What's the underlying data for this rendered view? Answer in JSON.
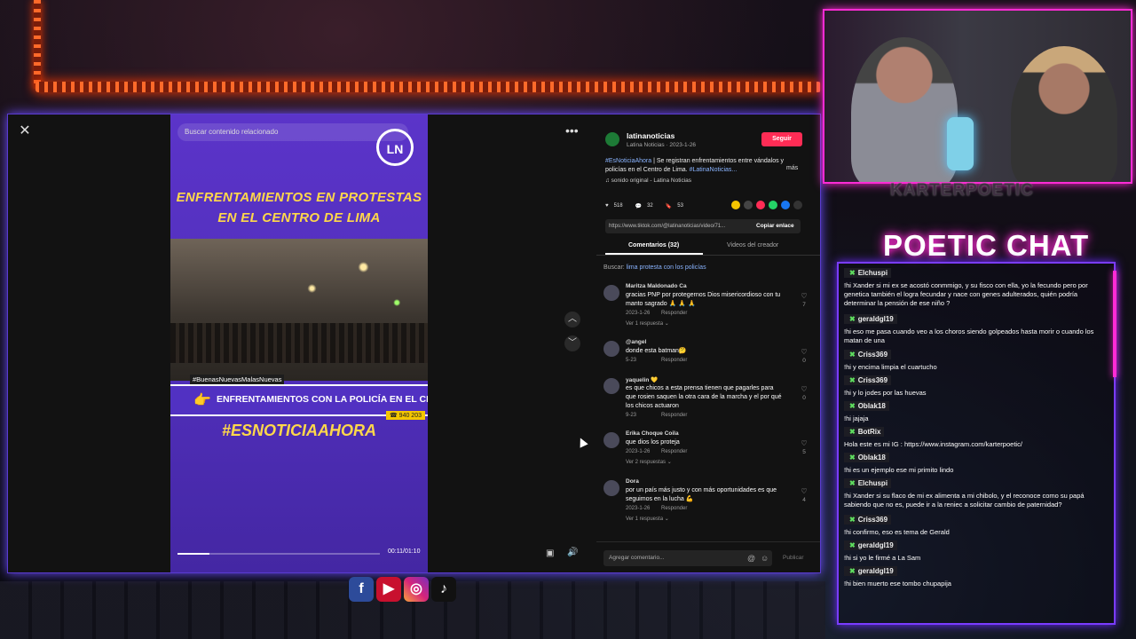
{
  "video": {
    "search_placeholder": "Buscar contenido relacionado",
    "logo_text": "LN",
    "headline_line1": "ENFRENTAMIENTOS EN PROTESTAS",
    "headline_line2": "EN EL CENTRO DE LIMA",
    "tag": "#BuenasNuevasMalasNuevas",
    "lower_third": "ENFRENTAMIENTOS CON LA POLICÍA EN EL CENTRO DE",
    "phone": "940 203",
    "hashtag": "#ESNOTICIAAHORA",
    "time": "00:11/01:10",
    "progress": 0.16
  },
  "post": {
    "account": "latinanoticias",
    "subtitle": "Latina Noticias · 2023-1-26",
    "follow_label": "Seguir",
    "desc_tag1": "#EsNoticiaAhora",
    "desc_text": " | Se registran enfrentamientos entre vándalos y policías en el Centro de Lima. ",
    "desc_tag2": "#LatinaNoticias...",
    "more_label": "más",
    "music": "♫ sonido original - Latina Noticias",
    "likes": "518",
    "comments": "32",
    "saves": "53",
    "link": "https://www.tiktok.com/@latinanoticias/video/71...",
    "copy_label": "Copiar enlace",
    "tab_comments": "Comentarios (32)",
    "tab_videos": "Videos del creador",
    "search_label": "Buscar:",
    "search_term": "lima protesta con los policías"
  },
  "comments": [
    {
      "user": "Maritza Maldonado Ca",
      "text": "gracias PNP por protegernos Dios misericordioso con tu manto sagrado 🙏 🙏 🙏",
      "date": "2023-1-26",
      "reply": "Responder",
      "likes": "7",
      "replies": "Ver 1 respuesta ⌄"
    },
    {
      "user": "@angel",
      "text": "donde esta batman🤔",
      "date": "5-23",
      "reply": "Responder",
      "likes": "0",
      "replies": ""
    },
    {
      "user": "yaquelin 💛",
      "text": "es que chicos a esta prensa tienen que pagarles para que rosien saquen la otra cara de la marcha y el por qué los chicos actuaron",
      "date": "9-23",
      "reply": "Responder",
      "likes": "0",
      "replies": ""
    },
    {
      "user": "Erika Choque Coila",
      "text": "que dios los proteja",
      "date": "2023-1-26",
      "reply": "Responder",
      "likes": "5",
      "replies": "Ver 2 respuestas ⌄"
    },
    {
      "user": "Dora",
      "text": "por un país más justo y con más oportunidades es que seguimos en la lucha 💪",
      "date": "2023-1-26",
      "reply": "Responder",
      "likes": "4",
      "replies": "Ver 1 respuesta ⌄"
    }
  ],
  "add_comment": {
    "placeholder": "Agregar comentario...",
    "publish": "Publicar"
  },
  "streamer": {
    "name": "KARTERPOETIC",
    "chat_title": "POETIC CHAT"
  },
  "chat": [
    {
      "name": "Elchuspi",
      "text": "!hi Xander si mi ex se acostó conmmigo, y su fisco con ella, yo la fecundo pero por genetica también el logra fecundar y nace con genes adulterados, quién podría determinar la pensión de ese niño ?"
    },
    {
      "name": "geraldgl19",
      "text": "!hi eso me pasa cuando veo a los choros siendo golpeados hasta morir o cuando los matan de una"
    },
    {
      "name": "Criss369",
      "text": "!hi y encima limpia el cuartucho"
    },
    {
      "name": "Criss369",
      "text": "!hi y lo jodes por las huevas"
    },
    {
      "name": "Oblak18",
      "text": "!hi jajaja"
    },
    {
      "name": "BotRix",
      "text": "Hola este es mi IG : https://www.instagram.com/karterpoetic/"
    },
    {
      "name": "Oblak18",
      "text": "!hi es un ejemplo ese mi primito lindo"
    },
    {
      "name": "Elchuspi",
      "text": "!hi Xander si su flaco de mi ex alimenta a mi chibolo, y el reconoce como su papá sabiendo que no es, puede ir a la reniec a solicitar cambio de paternidad?"
    },
    {
      "name": "Criss369",
      "text": "!hi confirmo, eso es tema de Gerald"
    },
    {
      "name": "geraldgl19",
      "text": "!hi si yo le firmé a La Sam"
    },
    {
      "name": "geraldgl19",
      "text": "!hi bien muerto ese tombo chupapija"
    }
  ],
  "colors": {
    "accent": "#fe2c55",
    "neon_pink": "#ff2bd5",
    "neon_purple": "#7a3cff"
  }
}
